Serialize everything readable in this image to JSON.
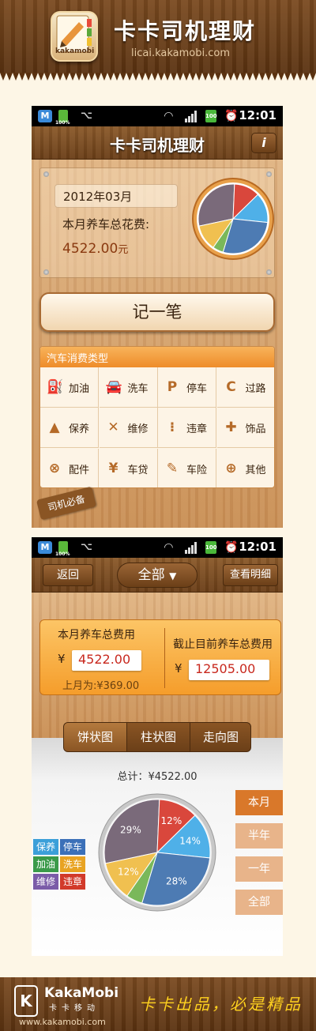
{
  "banner": {
    "title": "卡卡司机理财",
    "url": "licai.kakamobi.com",
    "icon_text": "kakamobi"
  },
  "status_bar": {
    "time": "12:01",
    "battery_text": "100",
    "battery_small": "100%"
  },
  "screen1": {
    "title": "卡卡司机理财",
    "info_label": "i",
    "month": "2012年03月",
    "total_label": "本月养车总花费:",
    "total_value": "4522.00",
    "total_unit": "元",
    "record_button": "记一笔",
    "category_header": "汽车消费类型",
    "categories": [
      {
        "label": "加油",
        "icon": "gas-pump-icon"
      },
      {
        "label": "洗车",
        "icon": "car-wash-icon"
      },
      {
        "label": "停车",
        "icon": "parking-icon"
      },
      {
        "label": "过路",
        "icon": "toll-road-icon"
      },
      {
        "label": "保养",
        "icon": "oil-can-icon"
      },
      {
        "label": "维修",
        "icon": "wrench-icon"
      },
      {
        "label": "违章",
        "icon": "traffic-light-icon"
      },
      {
        "label": "饰品",
        "icon": "puzzle-piece-icon"
      },
      {
        "label": "配件",
        "icon": "steering-wheel-icon"
      },
      {
        "label": "车贷",
        "icon": "money-icon"
      },
      {
        "label": "车险",
        "icon": "insurance-icon"
      },
      {
        "label": "其他",
        "icon": "plus-circle-icon"
      }
    ],
    "tag_label": "司机必备"
  },
  "screen2": {
    "back_button": "返回",
    "filter_label": "全部",
    "detail_button": "查看明细",
    "month_total_label": "本月养车总费用",
    "month_total_value": "4522.00",
    "last_month": "上月为:¥369.00",
    "all_total_label": "截止目前养车总费用",
    "all_total_value": "12505.00",
    "yen": "¥",
    "chart_tabs": [
      "饼状图",
      "柱状图",
      "走向图"
    ],
    "grand_total": "总计：¥4522.00",
    "ranges": [
      "本月",
      "半年",
      "一年",
      "全部"
    ],
    "legend": [
      {
        "label": "保养",
        "color": "#3b9fd9"
      },
      {
        "label": "停车",
        "color": "#3b70b8"
      },
      {
        "label": "加油",
        "color": "#3a9a4a"
      },
      {
        "label": "洗车",
        "color": "#e8a322"
      },
      {
        "label": "维修",
        "color": "#7b5ca8"
      },
      {
        "label": "违章",
        "color": "#d23a2a"
      }
    ]
  },
  "chart_data": {
    "type": "pie",
    "title": "",
    "total": 4522.0,
    "slices": [
      {
        "label": "29%",
        "value": 29,
        "color": "#7a6a7a"
      },
      {
        "label": "12%",
        "value": 12,
        "color": "#d9473c"
      },
      {
        "label": "14%",
        "value": 14,
        "color": "#4fb0e8"
      },
      {
        "label": "28%",
        "value": 28,
        "color": "#4d7bb3"
      },
      {
        "label": "",
        "value": 5,
        "color": "#7ab85a"
      },
      {
        "label": "12%",
        "value": 12,
        "color": "#f0c050"
      }
    ]
  },
  "footer": {
    "logo_letter": "K",
    "brand": "KakaMobi",
    "brand_sub": "卡卡移动",
    "url": "www.kakamobi.com",
    "slogan": "卡卡出品，必是精品"
  }
}
